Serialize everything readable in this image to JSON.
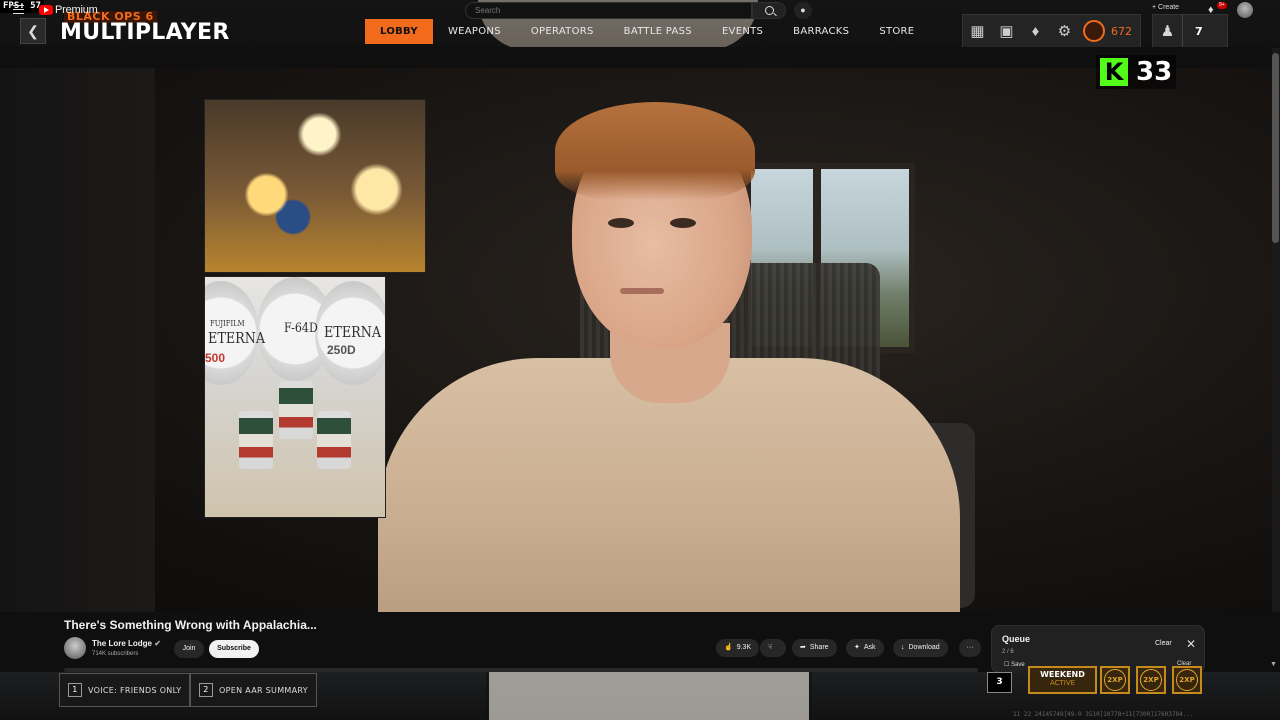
{
  "game_overlay": {
    "fps_label": "FPS:",
    "fps_value": "57",
    "logo_top": "BLACK OPS 6",
    "logo_main": "MULTIPLAYER",
    "nav": [
      {
        "label": "LOBBY",
        "active": true
      },
      {
        "label": "WEAPONS",
        "active": false
      },
      {
        "label": "OPERATORS",
        "active": false
      },
      {
        "label": "BATTLE PASS",
        "active": false
      },
      {
        "label": "EVENTS",
        "active": false
      },
      {
        "label": "BARRACKS",
        "active": false
      },
      {
        "label": "STORE",
        "active": false
      }
    ],
    "currency_amount": "672",
    "party_count": "7",
    "keybind_hints": [
      {
        "key": "1",
        "label": "VOICE: FRIENDS ONLY"
      },
      {
        "key": "2",
        "label": "OPEN AAR SUMMARY"
      }
    ],
    "hint_key_3": "3",
    "event_title": "WEEKEND",
    "event_status": "ACTIVE",
    "xp_tokens": [
      "2XP",
      "2XP",
      "2XP"
    ],
    "debug_text": "11 22 24145749[49-0 3510]10778+11[7300]17603784...",
    "accent_color": "#f26a1b"
  },
  "kick": {
    "logo_letter": "K",
    "viewer_count": "33",
    "brand_color": "#53fc18"
  },
  "youtube": {
    "brand": "Premium",
    "search_placeholder": "Search",
    "create_label": "Create",
    "notification_badge": "9+",
    "video_title": "There's Something Wrong with Appalachia...",
    "channel_name": "The Lore Lodge",
    "channel_subs": "714K subscribers",
    "join_label": "Join",
    "subscribe_label": "Subscribe",
    "like_count": "9.3K",
    "share_label": "Share",
    "ask_label": "Ask",
    "download_label": "Download",
    "more_label": "···",
    "queue": {
      "title": "Queue",
      "count": "2 / 6",
      "clear_label": "Clear",
      "save_label": "Save",
      "clear_label_2": "Clear"
    }
  },
  "film_cans": {
    "brand": "FUJIFILM",
    "labels": [
      "ETERNA",
      "F-64D",
      "ETERNA"
    ],
    "codes": [
      "500",
      "",
      "250D"
    ]
  }
}
